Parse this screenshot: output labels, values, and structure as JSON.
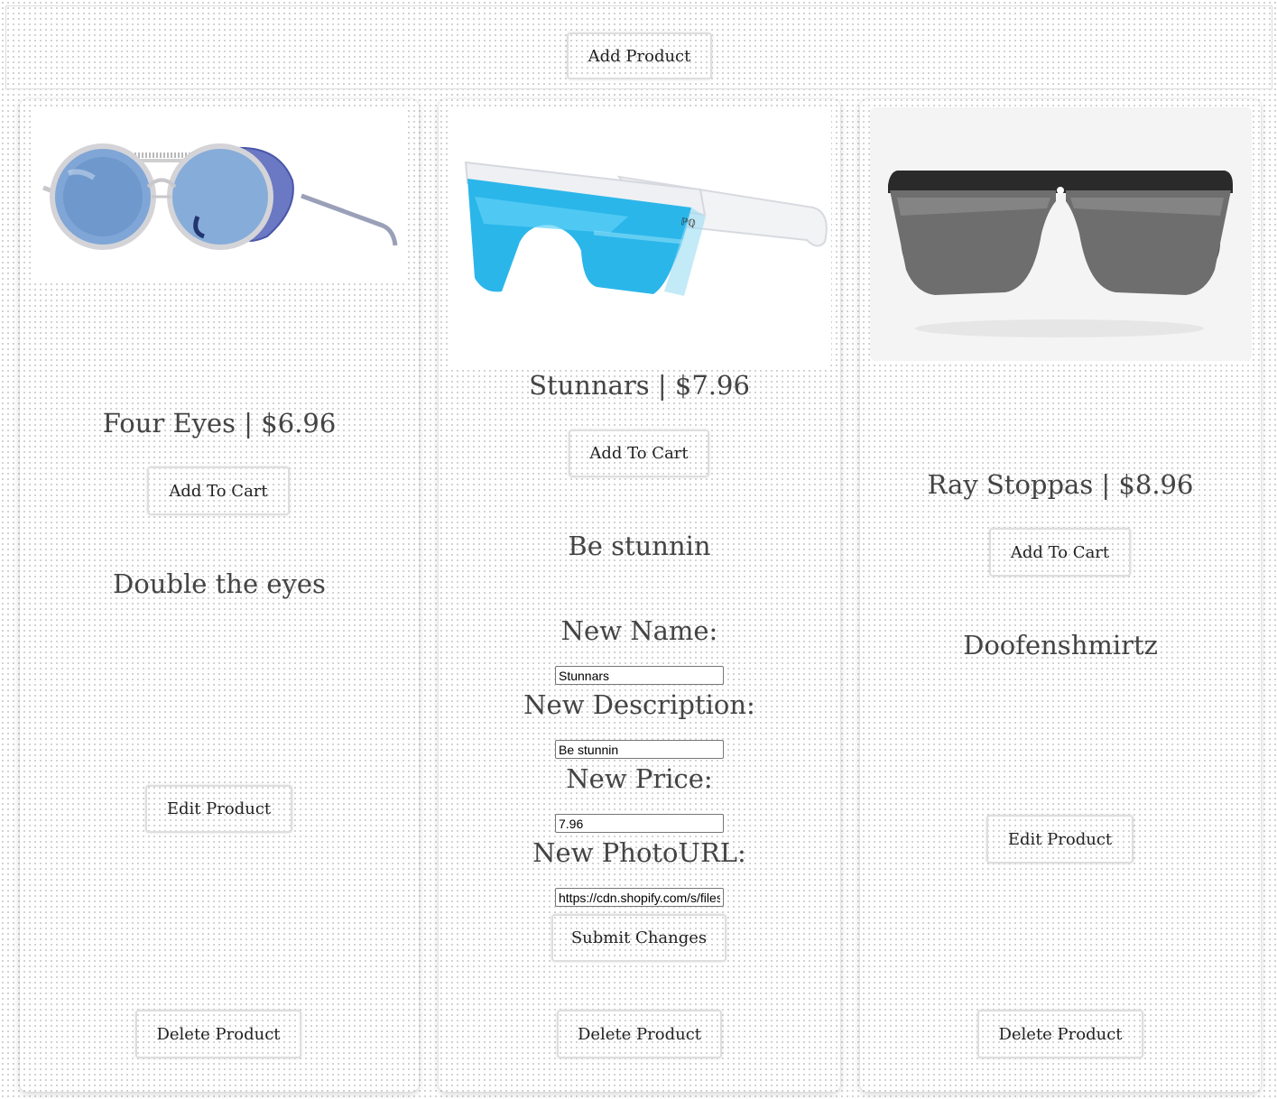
{
  "header": {
    "add_product_label": "Add Product"
  },
  "products": [
    {
      "title": "Four Eyes | $6.96",
      "description": "Double the eyes",
      "add_to_cart_label": "Add To Cart",
      "edit_label": "Edit Product",
      "delete_label": "Delete Product",
      "image_icon": "round-blue-steampunk-sunglasses"
    },
    {
      "title": "Stunnars | $7.96",
      "description": "Be stunnin",
      "add_to_cart_label": "Add To Cart",
      "delete_label": "Delete Product",
      "image_icon": "blue-mirrored-shield-sunglasses",
      "edit_form": {
        "name_label": "New Name:",
        "name_value": "Stunnars",
        "description_label": "New Description:",
        "description_value": "Be stunnin",
        "price_label": "New Price:",
        "price_value": "7.96",
        "photo_label": "New PhotoURL:",
        "photo_value": "https://cdn.shopify.com/s/files",
        "submit_label": "Submit Changes"
      }
    },
    {
      "title": "Ray Stoppas | $8.96",
      "description": "Doofenshmirtz",
      "add_to_cart_label": "Add To Cart",
      "edit_label": "Edit Product",
      "delete_label": "Delete Product",
      "image_icon": "grey-shield-sunglasses"
    }
  ]
}
